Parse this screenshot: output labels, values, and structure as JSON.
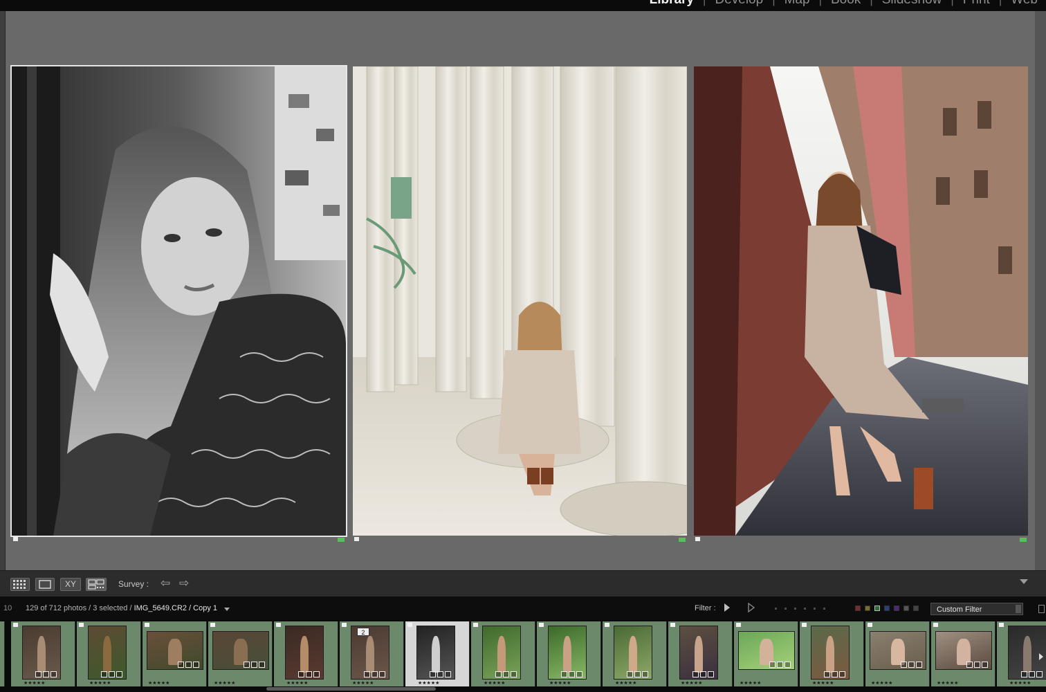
{
  "modules": [
    "Library",
    "Develop",
    "Map",
    "Book",
    "Slideshow",
    "Print",
    "Web"
  ],
  "active_module": "Library",
  "toolbar": {
    "view_modes": [
      "grid",
      "loupe",
      "compare",
      "survey"
    ],
    "compare_label": "XY",
    "survey_label": "Survey :"
  },
  "filmstrip_header": {
    "number": "10",
    "photo_count": "129 of 712 photos / 3 selected /",
    "filename": "IMG_5649.CR2 / Copy 1",
    "filter_label": "Filter :",
    "filter_preset": "Custom Filter"
  },
  "filter_colors": [
    "#c44a4a",
    "#c9b443",
    "#58c05a",
    "#4a6ec4",
    "#8a4ac4",
    "#888888",
    "#555555"
  ],
  "survey_candidates": [
    {
      "name": "bw-portrait",
      "selected": true
    },
    {
      "name": "colonnade-kneel",
      "selected": false
    },
    {
      "name": "alley-walk",
      "selected": false
    }
  ],
  "filmstrip": {
    "stars": "★★★★★",
    "stack_badge": "2",
    "thumbnails": [
      {
        "name": "thumb-portrait-1"
      },
      {
        "name": "thumb-window"
      },
      {
        "name": "thumb-wall-wide"
      },
      {
        "name": "thumb-wall-wide-2"
      },
      {
        "name": "thumb-door"
      },
      {
        "name": "thumb-door-stack"
      },
      {
        "name": "thumb-bw-selected"
      },
      {
        "name": "thumb-green-1"
      },
      {
        "name": "thumb-green-2"
      },
      {
        "name": "thumb-green-3"
      },
      {
        "name": "thumb-sitting"
      },
      {
        "name": "thumb-grass-wide"
      },
      {
        "name": "thumb-tree"
      },
      {
        "name": "thumb-wide-street"
      },
      {
        "name": "thumb-wide-laugh"
      },
      {
        "name": "thumb-dark-last"
      }
    ]
  }
}
